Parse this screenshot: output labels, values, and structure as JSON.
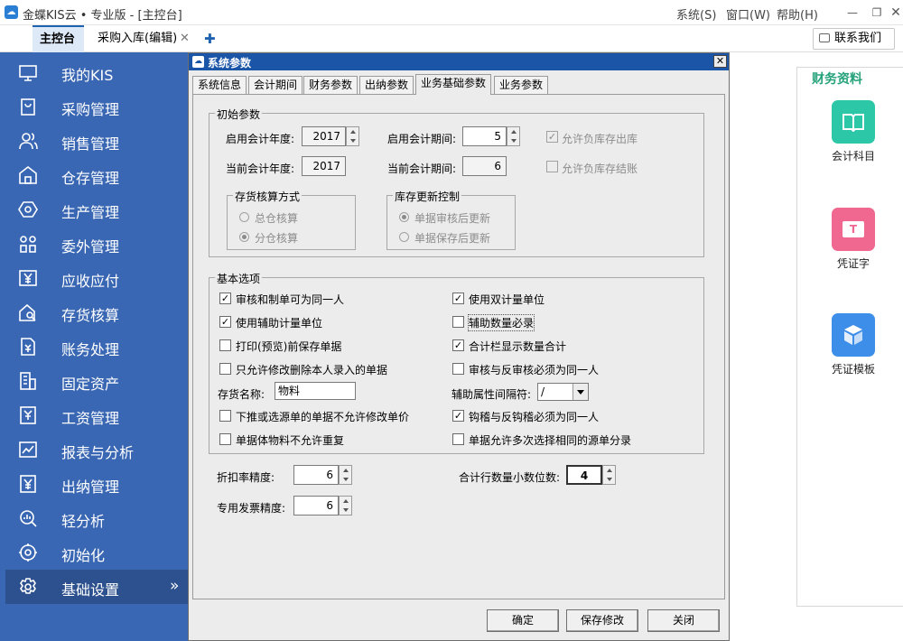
{
  "app": {
    "title": "金蝶KIS云 • 专业版 - [主控台]",
    "logo_glyph": "☁",
    "menu": [
      "系统(S)",
      "窗口(W)",
      "帮助(H)"
    ]
  },
  "tabs": {
    "main": "主控台",
    "purchase": "采购入库(编辑)",
    "close_glyph": "✕",
    "add_glyph": "✚"
  },
  "contact_label": "联系我们",
  "sidebar": {
    "items": [
      {
        "label": "我的KIS",
        "icon": "monitor-icon"
      },
      {
        "label": "采购管理",
        "icon": "bag-icon"
      },
      {
        "label": "销售管理",
        "icon": "people-icon"
      },
      {
        "label": "仓存管理",
        "icon": "warehouse-icon"
      },
      {
        "label": "生产管理",
        "icon": "hexagon-icon"
      },
      {
        "label": "委外管理",
        "icon": "grid-people-icon"
      },
      {
        "label": "应收应付",
        "icon": "yen-icon"
      },
      {
        "label": "存货核算",
        "icon": "house-search-icon"
      },
      {
        "label": "账务处理",
        "icon": "ledger-icon"
      },
      {
        "label": "固定资产",
        "icon": "building-icon"
      },
      {
        "label": "工资管理",
        "icon": "salary-icon"
      },
      {
        "label": "报表与分析",
        "icon": "chart-icon"
      },
      {
        "label": "出纳管理",
        "icon": "cashier-icon"
      },
      {
        "label": "轻分析",
        "icon": "magnifier-icon"
      },
      {
        "label": "初始化",
        "icon": "gear-circle-icon"
      },
      {
        "label": "基础设置",
        "icon": "gear-icon"
      }
    ],
    "active_index": 15,
    "arrow_glyph": "»"
  },
  "finance": {
    "title": "财务资料",
    "items": [
      {
        "label": "会计科目",
        "color": "#2cc7a7"
      },
      {
        "label": "凭证字",
        "color": "#f0678f",
        "glyph": "T"
      },
      {
        "label": "凭证模板",
        "color": "#3d8ee8"
      }
    ]
  },
  "dialog": {
    "title": "系统参数",
    "close_glyph": "✕",
    "tabs": [
      "系统信息",
      "会计期间",
      "财务参数",
      "出纳参数",
      "业务基础参数",
      "业务参数"
    ],
    "active_tab": 4,
    "initial": {
      "title": "初始参数",
      "start_year_label": "启用会计年度:",
      "start_year": "2017",
      "start_period_label": "启用会计期间:",
      "start_period": "5",
      "current_year_label": "当前会计年度:",
      "current_year": "2017",
      "current_period_label": "当前会计期间:",
      "current_period": "6",
      "allow_negative_out": "允许负库存出库",
      "allow_negative_close": "允许负库存结账",
      "costing": {
        "title": "存货核算方式",
        "opt1": "总仓核算",
        "opt2": "分仓核算"
      },
      "stock_update": {
        "title": "库存更新控制",
        "opt1": "单据审核后更新",
        "opt2": "单据保存后更新"
      }
    },
    "basic": {
      "title": "基本选项",
      "left": [
        {
          "label": "审核和制单可为同一人",
          "checked": true
        },
        {
          "label": "使用辅助计量单位",
          "checked": true
        },
        {
          "label": "打印(预览)前保存单据",
          "checked": false
        },
        {
          "label": "只允许修改删除本人录入的单据",
          "checked": false
        }
      ],
      "right": [
        {
          "label": "使用双计量单位",
          "checked": true
        },
        {
          "label": "辅助数量必录",
          "checked": false
        },
        {
          "label": "合计栏显示数量合计",
          "checked": true
        },
        {
          "label": "审核与反审核必须为同一人",
          "checked": false
        }
      ],
      "inventory_name_label": "存货名称:",
      "inventory_name": "物料",
      "aux_separator_label": "辅助属性间隔符:",
      "aux_separator": "/",
      "left2": [
        {
          "label": "下推或选源单的单据不允许修改单价",
          "checked": false
        },
        {
          "label": "单据体物料不允许重复",
          "checked": false
        }
      ],
      "right2": [
        {
          "label": "钩稽与反钩稽必须为同一人",
          "checked": true
        },
        {
          "label": "单据允许多次选择相同的源单分录",
          "checked": false
        }
      ]
    },
    "precision": {
      "discount_label": "折扣率精度:",
      "discount": "6",
      "invoice_label": "专用发票精度:",
      "invoice": "6",
      "total_qty_label": "合计行数量小数位数:",
      "total_qty": "4"
    },
    "buttons": {
      "ok": "确定",
      "save": "保存修改",
      "close": "关闭"
    }
  }
}
